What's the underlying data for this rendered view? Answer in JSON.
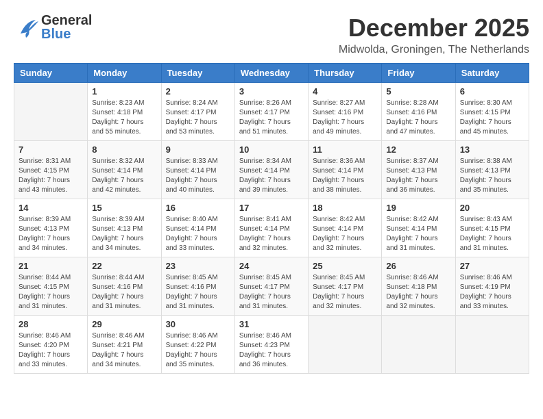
{
  "header": {
    "logo": {
      "general": "General",
      "blue": "Blue"
    },
    "month": "December 2025",
    "location": "Midwolda, Groningen, The Netherlands"
  },
  "calendar": {
    "headers": [
      "Sunday",
      "Monday",
      "Tuesday",
      "Wednesday",
      "Thursday",
      "Friday",
      "Saturday"
    ],
    "weeks": [
      [
        {
          "day": "",
          "info": ""
        },
        {
          "day": "1",
          "info": "Sunrise: 8:23 AM\nSunset: 4:18 PM\nDaylight: 7 hours\nand 55 minutes."
        },
        {
          "day": "2",
          "info": "Sunrise: 8:24 AM\nSunset: 4:17 PM\nDaylight: 7 hours\nand 53 minutes."
        },
        {
          "day": "3",
          "info": "Sunrise: 8:26 AM\nSunset: 4:17 PM\nDaylight: 7 hours\nand 51 minutes."
        },
        {
          "day": "4",
          "info": "Sunrise: 8:27 AM\nSunset: 4:16 PM\nDaylight: 7 hours\nand 49 minutes."
        },
        {
          "day": "5",
          "info": "Sunrise: 8:28 AM\nSunset: 4:16 PM\nDaylight: 7 hours\nand 47 minutes."
        },
        {
          "day": "6",
          "info": "Sunrise: 8:30 AM\nSunset: 4:15 PM\nDaylight: 7 hours\nand 45 minutes."
        }
      ],
      [
        {
          "day": "7",
          "info": "Sunrise: 8:31 AM\nSunset: 4:15 PM\nDaylight: 7 hours\nand 43 minutes."
        },
        {
          "day": "8",
          "info": "Sunrise: 8:32 AM\nSunset: 4:14 PM\nDaylight: 7 hours\nand 42 minutes."
        },
        {
          "day": "9",
          "info": "Sunrise: 8:33 AM\nSunset: 4:14 PM\nDaylight: 7 hours\nand 40 minutes."
        },
        {
          "day": "10",
          "info": "Sunrise: 8:34 AM\nSunset: 4:14 PM\nDaylight: 7 hours\nand 39 minutes."
        },
        {
          "day": "11",
          "info": "Sunrise: 8:36 AM\nSunset: 4:14 PM\nDaylight: 7 hours\nand 38 minutes."
        },
        {
          "day": "12",
          "info": "Sunrise: 8:37 AM\nSunset: 4:13 PM\nDaylight: 7 hours\nand 36 minutes."
        },
        {
          "day": "13",
          "info": "Sunrise: 8:38 AM\nSunset: 4:13 PM\nDaylight: 7 hours\nand 35 minutes."
        }
      ],
      [
        {
          "day": "14",
          "info": "Sunrise: 8:39 AM\nSunset: 4:13 PM\nDaylight: 7 hours\nand 34 minutes."
        },
        {
          "day": "15",
          "info": "Sunrise: 8:39 AM\nSunset: 4:13 PM\nDaylight: 7 hours\nand 34 minutes."
        },
        {
          "day": "16",
          "info": "Sunrise: 8:40 AM\nSunset: 4:14 PM\nDaylight: 7 hours\nand 33 minutes."
        },
        {
          "day": "17",
          "info": "Sunrise: 8:41 AM\nSunset: 4:14 PM\nDaylight: 7 hours\nand 32 minutes."
        },
        {
          "day": "18",
          "info": "Sunrise: 8:42 AM\nSunset: 4:14 PM\nDaylight: 7 hours\nand 32 minutes."
        },
        {
          "day": "19",
          "info": "Sunrise: 8:42 AM\nSunset: 4:14 PM\nDaylight: 7 hours\nand 31 minutes."
        },
        {
          "day": "20",
          "info": "Sunrise: 8:43 AM\nSunset: 4:15 PM\nDaylight: 7 hours\nand 31 minutes."
        }
      ],
      [
        {
          "day": "21",
          "info": "Sunrise: 8:44 AM\nSunset: 4:15 PM\nDaylight: 7 hours\nand 31 minutes."
        },
        {
          "day": "22",
          "info": "Sunrise: 8:44 AM\nSunset: 4:16 PM\nDaylight: 7 hours\nand 31 minutes."
        },
        {
          "day": "23",
          "info": "Sunrise: 8:45 AM\nSunset: 4:16 PM\nDaylight: 7 hours\nand 31 minutes."
        },
        {
          "day": "24",
          "info": "Sunrise: 8:45 AM\nSunset: 4:17 PM\nDaylight: 7 hours\nand 31 minutes."
        },
        {
          "day": "25",
          "info": "Sunrise: 8:45 AM\nSunset: 4:17 PM\nDaylight: 7 hours\nand 32 minutes."
        },
        {
          "day": "26",
          "info": "Sunrise: 8:46 AM\nSunset: 4:18 PM\nDaylight: 7 hours\nand 32 minutes."
        },
        {
          "day": "27",
          "info": "Sunrise: 8:46 AM\nSunset: 4:19 PM\nDaylight: 7 hours\nand 33 minutes."
        }
      ],
      [
        {
          "day": "28",
          "info": "Sunrise: 8:46 AM\nSunset: 4:20 PM\nDaylight: 7 hours\nand 33 minutes."
        },
        {
          "day": "29",
          "info": "Sunrise: 8:46 AM\nSunset: 4:21 PM\nDaylight: 7 hours\nand 34 minutes."
        },
        {
          "day": "30",
          "info": "Sunrise: 8:46 AM\nSunset: 4:22 PM\nDaylight: 7 hours\nand 35 minutes."
        },
        {
          "day": "31",
          "info": "Sunrise: 8:46 AM\nSunset: 4:23 PM\nDaylight: 7 hours\nand 36 minutes."
        },
        {
          "day": "",
          "info": ""
        },
        {
          "day": "",
          "info": ""
        },
        {
          "day": "",
          "info": ""
        }
      ]
    ]
  }
}
